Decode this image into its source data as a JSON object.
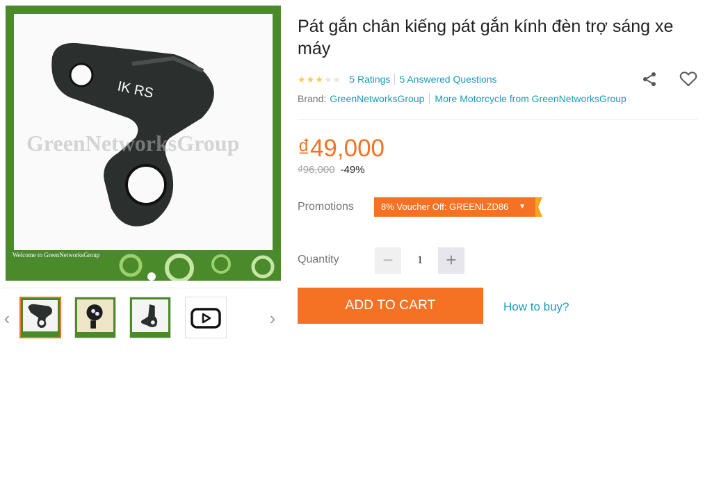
{
  "product": {
    "title": "Pát gắn chân kiếng pát gắn kính đèn trợ sáng xe máy",
    "image_watermark": "GreenNetworksGroup",
    "image_welcome": "Welcome to GreenNetworksGroup",
    "part_marking": "IK RS"
  },
  "gallery": {
    "thumbnails": [
      "bracket-photo",
      "headlight-photo",
      "bracket-side-photo",
      "video"
    ],
    "prev_icon": "chevron-left-icon",
    "next_icon": "chevron-right-icon"
  },
  "rating": {
    "stars_filled": 3,
    "stars_total": 5,
    "ratings_label": "5 Ratings",
    "questions_label": "5 Answered Questions"
  },
  "brand": {
    "label": "Brand:",
    "name": "GreenNetworksGroup",
    "more_label": "More Motorcycle from GreenNetworksGroup"
  },
  "pricing": {
    "price": "₫49,000",
    "original_price": "₫96,000",
    "discount": "-49%"
  },
  "promotions": {
    "label": "Promotions",
    "voucher": "8% Voucher Off: GREENLZD86"
  },
  "quantity": {
    "label": "Quantity",
    "value": "1",
    "minus": "−",
    "plus": "+"
  },
  "actions": {
    "add_to_cart": "ADD TO CART",
    "how_to_buy": "How to buy?"
  },
  "colors": {
    "accent": "#f57224",
    "link": "#1a9cb7",
    "star": "#faca51",
    "frame_green": "#4a8a2a"
  }
}
